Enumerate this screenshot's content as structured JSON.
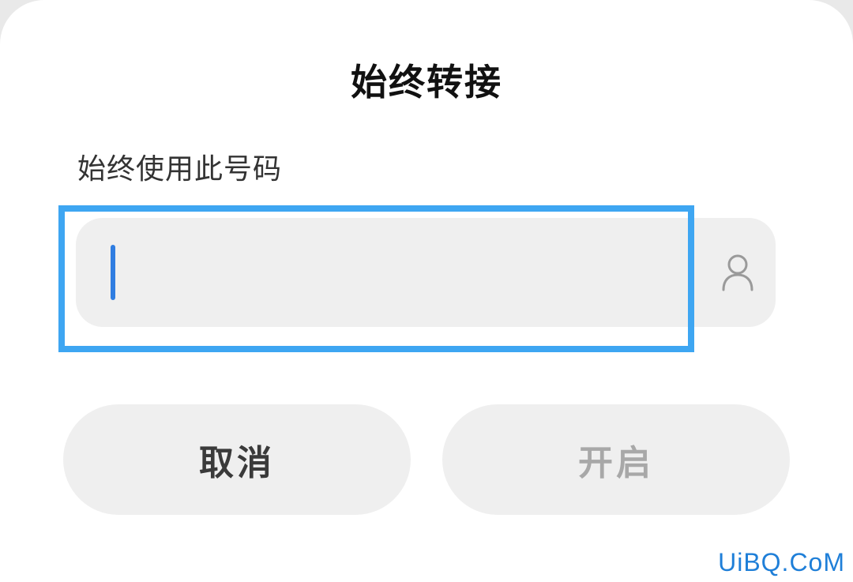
{
  "dialog": {
    "title": "始终转接",
    "subtitle": "始终使用此号码"
  },
  "input": {
    "value": "",
    "placeholder": ""
  },
  "buttons": {
    "cancel_label": "取消",
    "enable_label": "开启"
  },
  "icons": {
    "contact": "person-icon"
  },
  "colors": {
    "highlight": "#3ea6f2",
    "caret": "#2f7de1",
    "disabled_text": "#a8a8a8"
  },
  "watermark": "UiBQ.CoM"
}
